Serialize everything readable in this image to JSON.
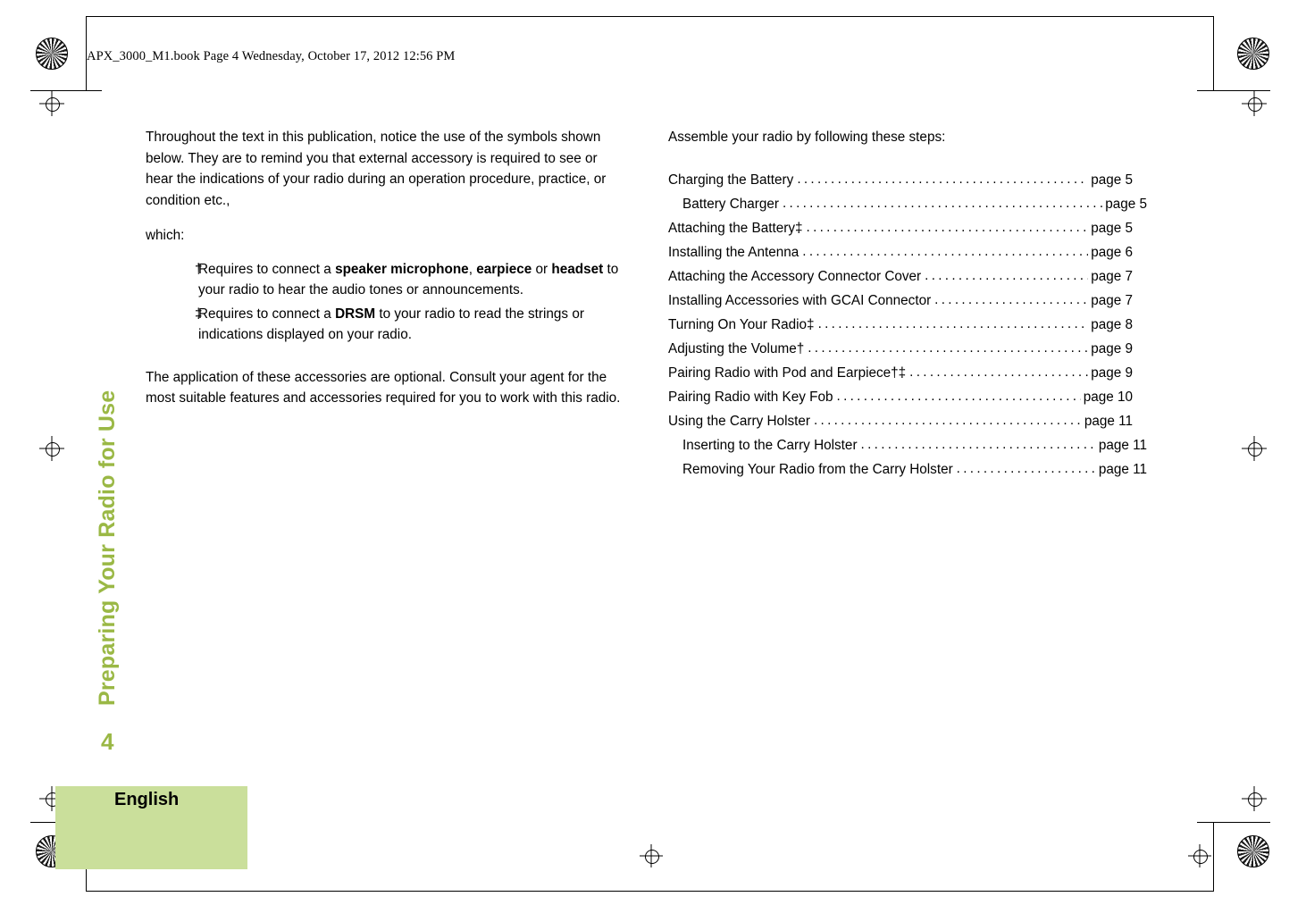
{
  "header": {
    "file_info": "APX_3000_M1.book  Page 4  Wednesday, October 17, 2012  12:56 PM"
  },
  "sidebar": {
    "chapter_title": "Preparing Your Radio for Use",
    "page_number": "4",
    "language": "English"
  },
  "left_column": {
    "intro_paragraph": "Throughout the text in this publication, notice the use of the symbols shown below. They are to remind you that external accessory is required to see or hear the indications of your radio during an operation procedure, practice, or condition etc.,",
    "intro_paragraph_tail": "which:",
    "symbols": [
      {
        "mark": "†",
        "text_parts": [
          {
            "text": "Requires to connect a ",
            "bold": false
          },
          {
            "text": "speaker microphone",
            "bold": true
          },
          {
            "text": ", ",
            "bold": false
          },
          {
            "text": "earpiece",
            "bold": true
          },
          {
            "text": " or ",
            "bold": false
          },
          {
            "text": "headset",
            "bold": true
          },
          {
            "text": " to your radio to hear the audio tones or announcements.",
            "bold": false
          }
        ]
      },
      {
        "mark": "‡",
        "text_parts": [
          {
            "text": "Requires to connect a ",
            "bold": false
          },
          {
            "text": "DRSM",
            "bold": true
          },
          {
            "text": " to your radio to read the strings or indications displayed on your radio.",
            "bold": false
          }
        ]
      }
    ],
    "closing_paragraph": "The application of these accessories are optional. Consult your agent for the most suitable features and accessories required for you to work with this radio."
  },
  "right_column": {
    "intro": "Assemble your radio by following these steps:",
    "toc": [
      {
        "title": "Charging the Battery",
        "page": "page 5",
        "indent": false
      },
      {
        "title": "Battery Charger",
        "page": "page 5",
        "indent": true
      },
      {
        "title": "Attaching the Battery‡",
        "page": "page 5",
        "indent": false
      },
      {
        "title": "Installing the Antenna",
        "page": "page 6",
        "indent": false
      },
      {
        "title": "Attaching the Accessory Connector Cover",
        "page": "page 7",
        "indent": false
      },
      {
        "title": "Installing Accessories with GCAI Connector",
        "page": "page 7",
        "indent": false
      },
      {
        "title": "Turning On Your Radio‡",
        "page": "page 8",
        "indent": false
      },
      {
        "title": "Adjusting the Volume†",
        "page": "page 9",
        "indent": false
      },
      {
        "title": "Pairing Radio with Pod and Earpiece†‡",
        "page": "page 9",
        "indent": false
      },
      {
        "title": "Pairing Radio with Key Fob",
        "page": "page 10",
        "indent": false
      },
      {
        "title": "Using the Carry Holster",
        "page": "page 11",
        "indent": false
      },
      {
        "title": "Inserting to the Carry Holster",
        "page": "page 11",
        "indent": true
      },
      {
        "title": "Removing Your Radio from the Carry Holster",
        "page": "page 11",
        "indent": true
      }
    ]
  },
  "colors": {
    "accent_green": "#9ab845",
    "language_box": "#cadf9b"
  }
}
